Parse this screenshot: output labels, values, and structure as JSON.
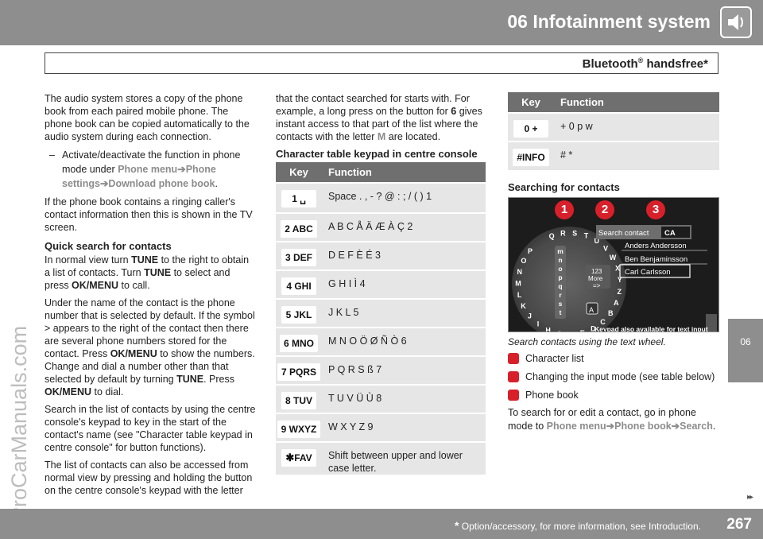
{
  "header": {
    "chapter_title": "06 Infotainment system",
    "section_title": "Bluetooth",
    "section_sup": "®",
    "section_suffix": " handsfree*",
    "icon": "speaker-icon"
  },
  "side_tab": {
    "label": "06"
  },
  "watermark": {
    "text": "ProCarManuals.com"
  },
  "column1": {
    "intro": "The audio system stores a copy of the phone book from each paired mobile phone. The phone book can be copied automatically to the audio system during each connection.",
    "bullet_dash": "–",
    "bullet_text": "Activate/deactivate the function in phone mode under ",
    "menu_1": "Phone menu",
    "menu_2": "Phone settings",
    "menu_3": "Download phone book",
    "arrow": "➔",
    "period": ".",
    "ringing_para": "If the phone book contains a ringing caller's contact information then this is shown in the TV screen.",
    "quick_heading": "Quick search for contacts",
    "quick_p1_a": "In normal view turn ",
    "quick_p1_tune": "TUNE",
    "quick_p1_b": " to the right to obtain a list of contacts. Turn ",
    "quick_p1_tune2": "TUNE",
    "quick_p1_c": " to select and press ",
    "quick_p1_ok": "OK/MENU",
    "quick_p1_d": " to call.",
    "quick_p2_a": "Under the name of the contact is the phone number that is selected by default. If the symbol > appears to the right of the contact then there are several phone numbers stored for the contact. Press ",
    "quick_p2_ok": "OK/MENU",
    "quick_p2_b": " to show the numbers. Change and dial a number other than that selected by default by turning ",
    "quick_p2_tune": "TUNE",
    "quick_p2_c": ". Press ",
    "quick_p2_ok2": "OK/MENU",
    "quick_p2_d": " to dial.",
    "quick_p3": "Search in the list of contacts by using the centre console's keypad to key in the start of the contact's name (see \"Character table keypad in centre console\" for button functions).",
    "quick_p4": "The list of contacts can also be accessed from normal view by pressing and holding the button on the centre console's keypad with the letter"
  },
  "column2": {
    "p1_a": "that the contact searched for starts with. For example, a long press on the button for ",
    "p1_six": "6",
    "p1_b": " gives instant access to that part of the list where the contacts with the letter ",
    "p1_m": "M",
    "p1_c": " are located.",
    "table_heading": "Character table keypad in centre console",
    "table": {
      "col_key": "Key",
      "col_function": "Function",
      "rows": [
        {
          "key": "1  ␣",
          "function": "Space . , - ? @ : ; / ( ) 1"
        },
        {
          "key": "2 ABC",
          "function": "A B C Å Ä Æ À Ç 2"
        },
        {
          "key": "3 DEF",
          "function": "D E F È É 3"
        },
        {
          "key": "4 GHI",
          "function": "G H I Ì 4"
        },
        {
          "key": "5 JKL",
          "function": "J K L 5"
        },
        {
          "key": "6 MNO",
          "function": "M N O Ö Ø Ñ Ò 6"
        },
        {
          "key": "7 PQRS",
          "function": "P Q R S ß 7"
        },
        {
          "key": "8 TUV",
          "function": "T U V Ü Ù 8"
        },
        {
          "key": "9 WXYZ",
          "function": "W X Y Z 9"
        },
        {
          "key_star": "✱",
          "key": "FAV",
          "function": "Shift between upper and lower case letter."
        }
      ]
    }
  },
  "column3": {
    "table": {
      "col_key": "Key",
      "col_function": "Function",
      "rows": [
        {
          "key": "0  +",
          "function": "+ 0 p w"
        },
        {
          "key": "#INFO",
          "function": "# *"
        }
      ]
    },
    "search_heading": "Searching for contacts",
    "screen": {
      "title": "Search contact",
      "typed": "CA",
      "contacts": [
        "Anders Andersson",
        "Ben Benjaminsson",
        "Carl Carlsson"
      ],
      "more_top": "123",
      "more_mid": "More",
      "more_bot": "=>",
      "mode_key": "A",
      "hint": "Keypad also available for text input",
      "wheel_letters": [
        "Q",
        "R",
        "S",
        "T",
        "U",
        "V",
        "W",
        "X",
        "Y",
        "Z",
        "A",
        "B",
        "C",
        "D",
        "E",
        "F",
        "G",
        "H",
        "I",
        "J",
        "K",
        "L",
        "M",
        "N",
        "O",
        "P"
      ],
      "inner_letters": [
        "m",
        "n",
        "o",
        "p",
        "q",
        "r",
        "s",
        "t"
      ],
      "callouts": [
        "1",
        "2",
        "3"
      ]
    },
    "caption": "Search contacts using the text wheel.",
    "legend": [
      "Character list",
      "Changing the input mode (see table below)",
      "Phone book"
    ],
    "edit_a": "To search for or edit a contact, go in phone mode to ",
    "edit_menu1": "Phone menu",
    "edit_menu2": "Phone book",
    "edit_menu3": "Search",
    "arrow": "➔",
    "period": "."
  },
  "footer": {
    "asterisk": "*",
    "footnote": " Option/accessory, for more information, see Introduction.",
    "page_number": "267",
    "next_arrows": "▸▸"
  },
  "colors": {
    "bar_gray": "#8e8e8e",
    "table_header": "#6f6f6f",
    "table_row": "#e6e6e6",
    "callout_red": "#d8202b",
    "menu_gray": "#8c8c8c"
  }
}
